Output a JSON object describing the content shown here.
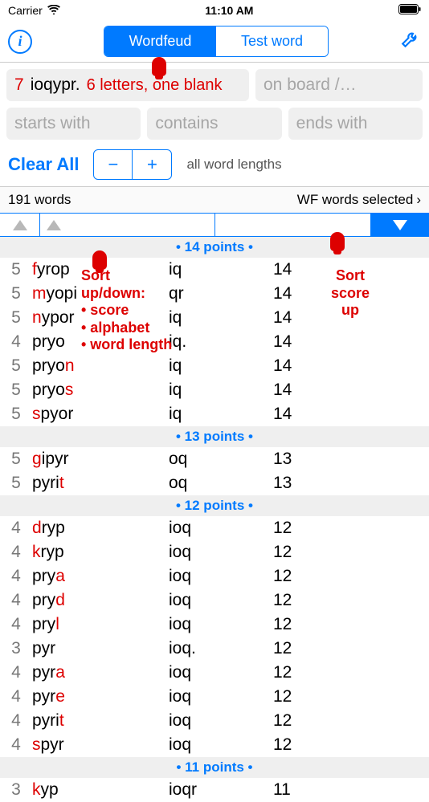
{
  "status": {
    "carrier": "Carrier",
    "time": "11:10 AM"
  },
  "nav": {
    "tab1": "Wordfeud",
    "tab2": "Test word"
  },
  "inputs": {
    "count": "7",
    "letters": "ioqypr.",
    "status": "6 letters, one blank",
    "board_ph": "on board /…",
    "starts_ph": "starts with",
    "contains_ph": "contains",
    "ends_ph": "ends with"
  },
  "controls": {
    "clear": "Clear All",
    "all_lengths": "all word lengths"
  },
  "count_row": {
    "words": "191 words",
    "selected": "WF words selected"
  },
  "annotations": {
    "sort_left": "Sort\nup/down:\n• score\n• alphabet\n• word length",
    "sort_right": "Sort\nscore\nup"
  },
  "sections": [
    {
      "header": "• 14 points •",
      "rows": [
        {
          "len": "5",
          "pre": "f",
          "rest": "yrop",
          "mid": "iq",
          "score": "14"
        },
        {
          "len": "5",
          "pre": "m",
          "rest": "yopi",
          "mid": "qr",
          "score": "14"
        },
        {
          "len": "5",
          "pre": "n",
          "rest": "ypor",
          "mid": "iq",
          "score": "14"
        },
        {
          "len": "4",
          "pre": "",
          "rest": "pryo",
          "mid": "iq.",
          "score": "14"
        },
        {
          "len": "5",
          "pre": "",
          "rest": "pryo",
          "suf": "n",
          "mid": "iq",
          "score": "14"
        },
        {
          "len": "5",
          "pre": "",
          "rest": "pryo",
          "suf": "s",
          "mid": "iq",
          "score": "14"
        },
        {
          "len": "5",
          "pre": "s",
          "rest": "pyor",
          "mid": "iq",
          "score": "14"
        }
      ]
    },
    {
      "header": "• 13 points •",
      "rows": [
        {
          "len": "5",
          "pre": "g",
          "rest": "ipyr",
          "mid": "oq",
          "score": "13"
        },
        {
          "len": "5",
          "pre": "",
          "rest": "pyri",
          "suf": "t",
          "mid": "oq",
          "score": "13"
        }
      ]
    },
    {
      "header": "• 12 points •",
      "rows": [
        {
          "len": "4",
          "pre": "d",
          "rest": "ryp",
          "mid": "ioq",
          "score": "12"
        },
        {
          "len": "4",
          "pre": "k",
          "rest": "ryp",
          "mid": "ioq",
          "score": "12"
        },
        {
          "len": "4",
          "pre": "",
          "rest": "pry",
          "suf": "a",
          "mid": "ioq",
          "score": "12"
        },
        {
          "len": "4",
          "pre": "",
          "rest": "pry",
          "suf": "d",
          "mid": "ioq",
          "score": "12"
        },
        {
          "len": "4",
          "pre": "",
          "rest": "pry",
          "suf": "l",
          "mid": "ioq",
          "score": "12"
        },
        {
          "len": "3",
          "pre": "",
          "rest": "pyr",
          "mid": "ioq.",
          "score": "12"
        },
        {
          "len": "4",
          "pre": "",
          "rest": "pyr",
          "suf": "a",
          "mid": "ioq",
          "score": "12"
        },
        {
          "len": "4",
          "pre": "",
          "rest": "pyr",
          "suf": "e",
          "mid": "ioq",
          "score": "12"
        },
        {
          "len": "4",
          "pre": "",
          "rest": "pyri",
          "suf": "t",
          "mid": "ioq",
          "score": "12"
        },
        {
          "len": "4",
          "pre": "s",
          "rest": "pyr",
          "mid": "ioq",
          "score": "12"
        }
      ]
    },
    {
      "header": "• 11 points •",
      "rows": [
        {
          "len": "3",
          "pre": "k",
          "rest": "yp",
          "mid": "ioqr",
          "score": "11"
        }
      ]
    }
  ]
}
